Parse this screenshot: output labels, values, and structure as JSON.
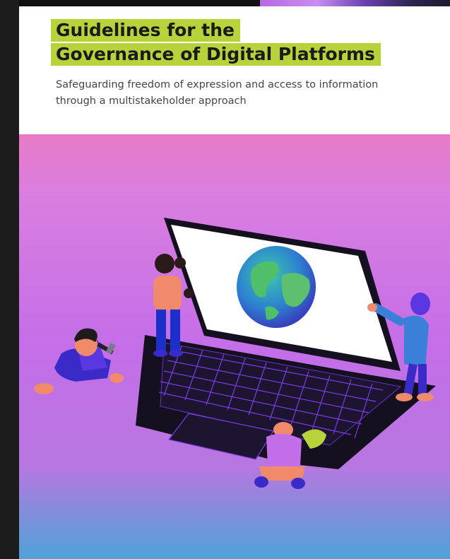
{
  "document": {
    "title_line1": "Guidelines for the",
    "title_line2": "Governance of Digital Platforms",
    "subtitle_line1": "Safeguarding freedom of expression and access to information",
    "subtitle_line2": "through a multistakeholder approach"
  },
  "colors": {
    "title_highlight": "#b7d33c",
    "cover_top": "#e87bc8",
    "cover_middle": "#c46ee8",
    "cover_bottom": "#4fa2d8",
    "laptop": "#15101f"
  }
}
